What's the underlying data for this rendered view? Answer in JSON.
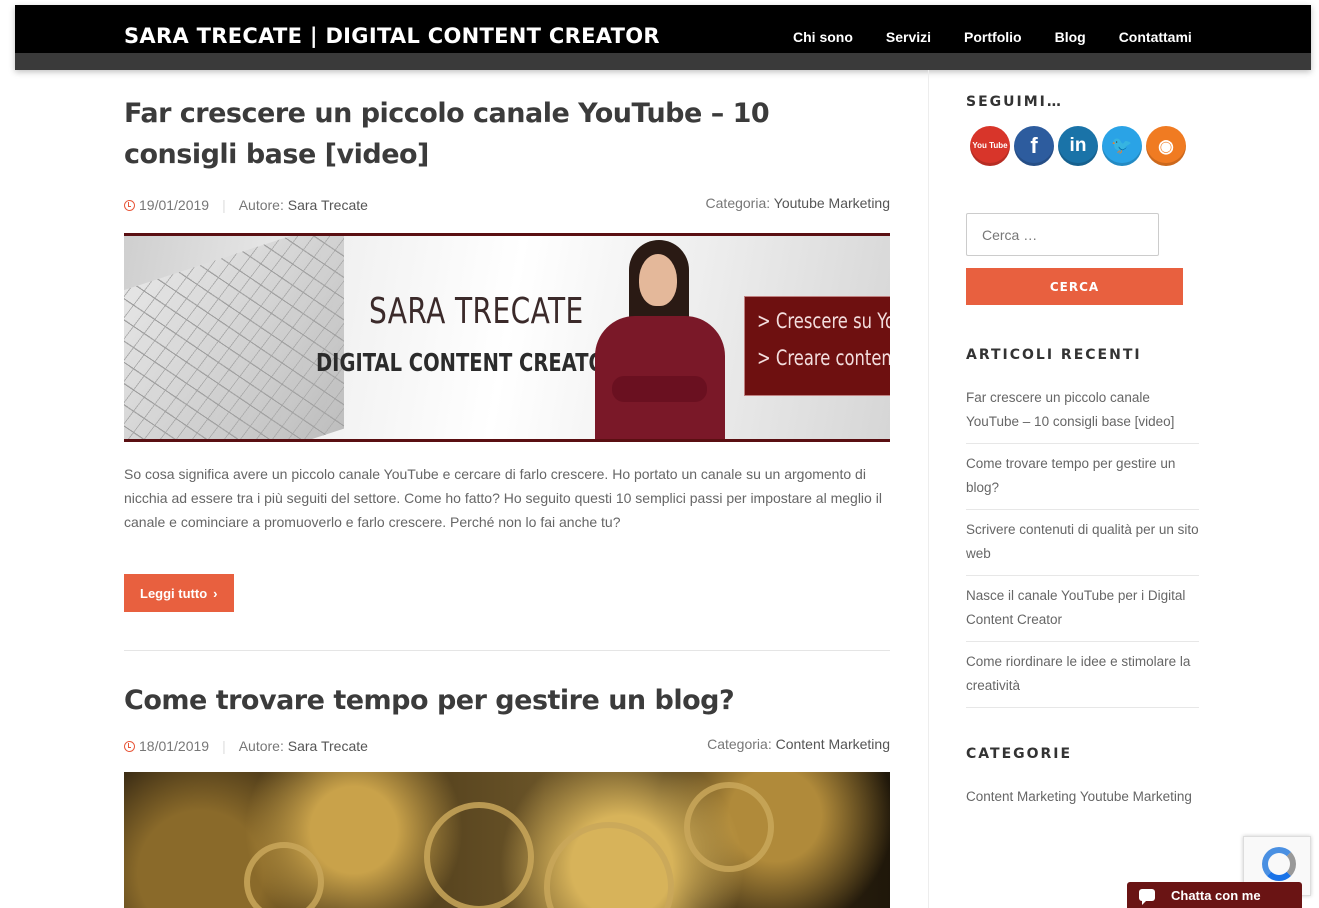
{
  "header": {
    "site_title": "SARA TRECATE | DIGITAL CONTENT CREATOR",
    "nav": [
      "Chi sono",
      "Servizi",
      "Portfolio",
      "Blog",
      "Contattami"
    ]
  },
  "posts": [
    {
      "title": "Far crescere un piccolo canale YouTube – 10 consigli base [video]",
      "date": "19/01/2019",
      "author_label": "Autore:",
      "author": "Sara Trecate",
      "category_label": "Categoria:",
      "category": "Youtube Marketing",
      "banner": {
        "name": "SARA TRECATE",
        "subtitle": "DIGITAL CONTENT CREATOR",
        "lines": [
          "> Crescere su Yo",
          "> Creare contenu"
        ]
      },
      "excerpt": "So cosa significa avere un piccolo canale YouTube e cercare di farlo crescere. Ho portato un canale su un argomento di nicchia ad essere tra i più seguiti del settore. Come ho fatto? Ho seguito questi 10 semplici passi per impostare al meglio il canale e cominciare a promuoverlo e farlo crescere. Perché non lo fai anche tu?",
      "read_more": "Leggi tutto"
    },
    {
      "title": "Come trovare tempo per gestire un blog?",
      "date": "18/01/2019",
      "author_label": "Autore:",
      "author": "Sara Trecate",
      "category_label": "Categoria:",
      "category": "Content Marketing"
    }
  ],
  "sidebar": {
    "follow_title": "SEGUIMI…",
    "social": [
      {
        "name": "youtube-icon",
        "glyph": "You Tube",
        "color": "#d8352a"
      },
      {
        "name": "facebook-icon",
        "glyph": "f",
        "color": "#2d5c9e"
      },
      {
        "name": "linkedin-icon",
        "glyph": "in",
        "color": "#1a73a8"
      },
      {
        "name": "twitter-icon",
        "glyph": "🐦",
        "color": "#2aa3e6"
      },
      {
        "name": "rss-icon",
        "glyph": "◉",
        "color": "#f07b22"
      }
    ],
    "search_placeholder": "Cerca …",
    "search_button": "CERCA",
    "recent_title": "ARTICOLI RECENTI",
    "recent": [
      "Far crescere un piccolo canale YouTube – 10 consigli base [video]",
      "Come trovare tempo per gestire un blog?",
      "Scrivere contenuti di qualità per un sito web",
      "Nasce il canale YouTube per i Digital Content Creator",
      "Come riordinare le idee e stimolare la creatività"
    ],
    "categories_title": "CATEGORIE",
    "categories": [
      "Content Marketing",
      "Youtube Marketing"
    ]
  },
  "chat_label": "Chatta con me",
  "colors": {
    "accent": "#e8603f",
    "header": "#000000",
    "brand_red": "#6e1010"
  }
}
